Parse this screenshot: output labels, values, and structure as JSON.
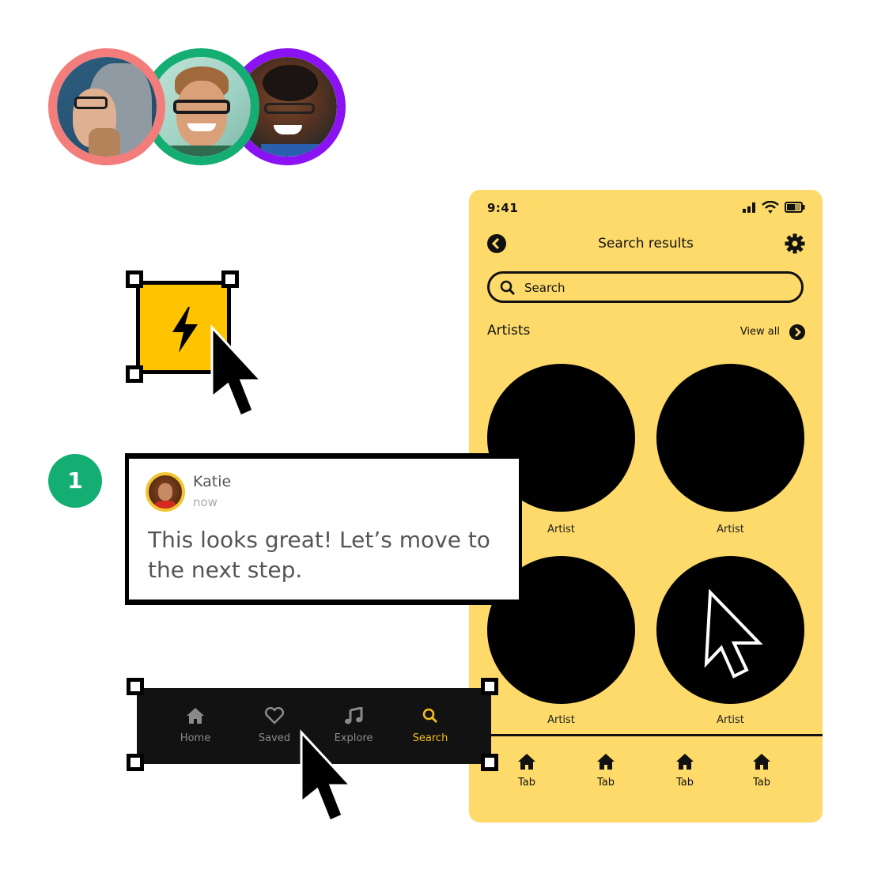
{
  "avatars": [
    {
      "name": "avatar-hooded-woman",
      "ring_color": "#F37D7A"
    },
    {
      "name": "avatar-man-glasses",
      "ring_color": "#14AE73"
    },
    {
      "name": "avatar-woman-curly-hair",
      "ring_color": "#8B12F2"
    }
  ],
  "phone": {
    "status_time": "9:41",
    "title": "Search results",
    "search_placeholder": "Search",
    "section_title": "Artists",
    "view_all": "View all",
    "artists": [
      {
        "label": "Artist"
      },
      {
        "label": "Artist"
      },
      {
        "label": "Artist"
      },
      {
        "label": "Artist"
      }
    ],
    "tabs": [
      {
        "label": "Tab",
        "icon": "home-icon"
      },
      {
        "label": "Tab",
        "icon": "home-icon"
      },
      {
        "label": "Tab",
        "icon": "home-icon"
      },
      {
        "label": "Tab",
        "icon": "home-icon"
      }
    ],
    "background_color": "#FDDA6A"
  },
  "component": {
    "icon": "lightning-icon",
    "fill_color": "#FFC400"
  },
  "step_badge": {
    "number": "1",
    "color": "#14AE73"
  },
  "comment": {
    "author": "Katie",
    "time": "now",
    "text": "This looks great! Let’s move to the next step."
  },
  "navbar": {
    "items": [
      {
        "label": "Home",
        "icon": "home-icon",
        "active": false
      },
      {
        "label": "Saved",
        "icon": "heart-icon",
        "active": false
      },
      {
        "label": "Explore",
        "icon": "music-note-icon",
        "active": false
      },
      {
        "label": "Search",
        "icon": "search-icon",
        "active": true
      }
    ],
    "active_color": "#F4BE1E"
  }
}
